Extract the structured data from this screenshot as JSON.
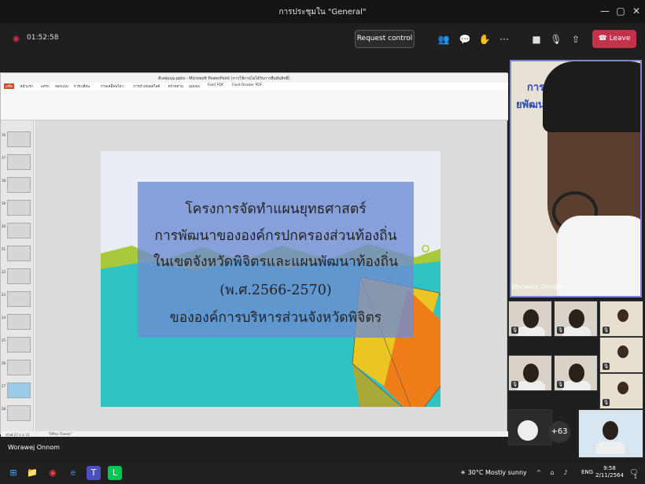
{
  "window": {
    "title": "การประชุมใน \"General\""
  },
  "meeting": {
    "timer": "01:52:58",
    "request_control_label": "Request control",
    "leave_label": "Leave"
  },
  "powerpoint": {
    "title": "ดีเอชุมนุม.pptx - Microsoft PowerPoint (การใช้งานไม่ได้รับการยืนยันสิทธิ์)",
    "tabs": [
      "แฟ้ม",
      "หน้าแรก",
      "แทรก",
      "ออกแบบ",
      "การเปลี่ยน",
      "ภาพเคลื่อนไหว",
      "การนำเสนอสไลด์",
      "ตรวจทาน",
      "มุมมอง",
      "Foxit PDF",
      "Foxit Reader PDF"
    ],
    "status_left": "สไลด์ 27 จาก 31",
    "status_theme": "\"Office Theme\"",
    "slide_thumbnails": [
      "16",
      "17",
      "18",
      "19",
      "20",
      "21",
      "22",
      "23",
      "24",
      "25",
      "26",
      "27",
      "28"
    ]
  },
  "slide": {
    "lines": [
      "โครงการจัดทำแผนยุทธศาสตร์",
      "การพัฒนาขององค์กรปกครองส่วนท้องถิ่น",
      "ในเขตจังหวัดพิจิตรและแผนพัฒนาท้องถิ่น",
      "(พ.ศ.2566-2570)",
      "ขององค์การบริหารส่วนจังหวัดพิจิตร"
    ],
    "background_text": [
      "การศึกษา",
      "ยพัฒนา"
    ],
    "accent_colors": {
      "box": "#6e8cd2",
      "teal": "#2ec4c4",
      "lime": "#a8c93a",
      "gold": "#f5c518",
      "orange": "#f07d1a"
    }
  },
  "participants": {
    "main_name": "Worawej Onnom",
    "overflow_count": "+63",
    "bottom_label": "Worawej Onnom"
  },
  "taskbar": {
    "weather_temp": "30°C",
    "weather_text": "Mostly sunny",
    "lang": "ENG",
    "time": "9:58",
    "date": "2/11/2564",
    "notification_count": "1"
  }
}
